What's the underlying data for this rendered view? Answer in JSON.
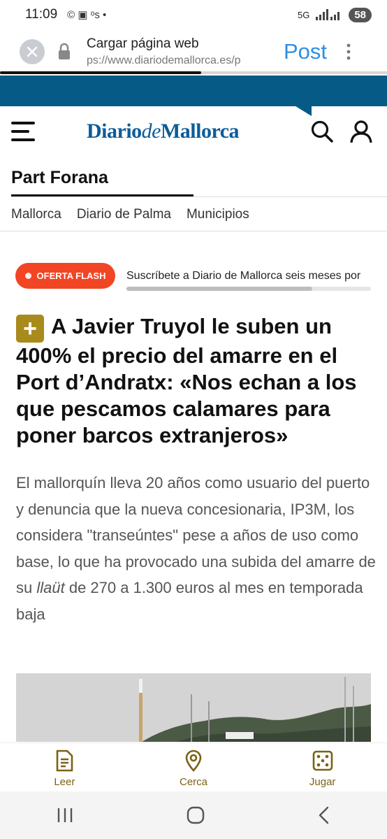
{
  "status_bar": {
    "time": "11:09",
    "left_glyphs": "© ▣ ᵒs •",
    "network": "5G",
    "battery": "58"
  },
  "webview": {
    "title": "Cargar página web",
    "url": "ps://www.diariodemallorca.es/p",
    "post_label": "Post",
    "load_progress": 0.52
  },
  "site": {
    "logo_main": "Diario",
    "logo_de": "de",
    "logo_end": "Mallorca"
  },
  "section": {
    "title": "Part Forana",
    "subnav": [
      "Mallorca",
      "Diario de Palma",
      "Municipios"
    ]
  },
  "promo": {
    "badge": "OFERTA FLASH",
    "text": "Suscríbete a Diario de Mallorca seis meses por"
  },
  "article": {
    "premium_symbol": "+",
    "headline": "A Javier Truyol le suben un 400% el precio del amarre en el Port d’Andratx: «Nos echan a los que pescamos calamares para poner barcos extranjeros»",
    "lead_before": "El mallorquín lleva 20 años como usuario del puerto y denuncia que la nueva concesionaria, IP3M, los considera \"transeúntes\" pese a años de uso como base, lo que ha provocado una subida del amarre de su ",
    "lead_italic": "llaüt",
    "lead_after": " de 270 a 1.300 euros al mes en temporada baja"
  },
  "bottom_nav": [
    {
      "label": "Leer",
      "icon": "document-icon"
    },
    {
      "label": "Cerca",
      "icon": "location-pin-icon"
    },
    {
      "label": "Jugar",
      "icon": "dice-icon"
    }
  ],
  "colors": {
    "brand_blue": "#065a86",
    "logo_blue": "#0c5c99",
    "flash_red": "#f24524",
    "gold": "#a98a1d",
    "nav_gold": "#7a6214",
    "post_blue": "#2f8fe0"
  }
}
